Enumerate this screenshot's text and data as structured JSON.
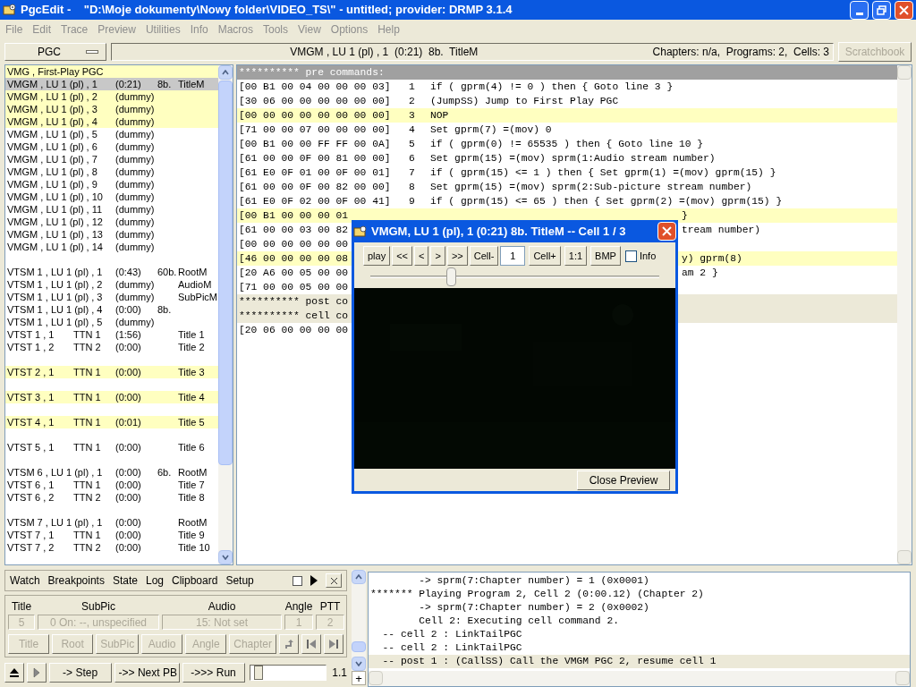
{
  "window": {
    "title": "PgcEdit -    \"D:\\Moje dokumenty\\Nowy folder\\VIDEO_TS\\\" - untitled; provider: DRMP 3.1.4"
  },
  "menu": [
    "File",
    "Edit",
    "Trace",
    "Preview",
    "Utilities",
    "Info",
    "Macros",
    "Tools",
    "View",
    "Options",
    "Help"
  ],
  "toolbar": {
    "selector": "PGC",
    "current": "VMGM , LU 1 (pl) , 1  (0:21)  8b.  TitleM",
    "summary": "Chapters: n/a,  Programs: 2,  Cells: 3",
    "scratchbook": {
      "label": "Scratchbook",
      "disabled": true
    }
  },
  "pgc_list": [
    {
      "kind": "item",
      "name": "VMG , First-Play PGC",
      "highlighted": true,
      "selected": false
    },
    {
      "kind": "item",
      "name": "VMGM , LU 1 (pl) , 1",
      "time": "(0:21)",
      "size": "8b.",
      "type": "TitleM",
      "highlighted": false,
      "selected": true
    },
    {
      "kind": "item",
      "name": "VMGM , LU 1 (pl) , 2",
      "time": "(dummy)",
      "highlighted": true,
      "selected": false
    },
    {
      "kind": "item",
      "name": "VMGM , LU 1 (pl) , 3",
      "time": "(dummy)",
      "highlighted": true,
      "selected": false
    },
    {
      "kind": "item",
      "name": "VMGM , LU 1 (pl) , 4",
      "time": "(dummy)",
      "highlighted": true,
      "selected": false
    },
    {
      "kind": "item",
      "name": "VMGM , LU 1 (pl) , 5",
      "time": "(dummy)",
      "highlighted": false,
      "selected": false
    },
    {
      "kind": "item",
      "name": "VMGM , LU 1 (pl) , 6",
      "time": "(dummy)",
      "highlighted": false,
      "selected": false
    },
    {
      "kind": "item",
      "name": "VMGM , LU 1 (pl) , 7",
      "time": "(dummy)",
      "highlighted": false,
      "selected": false
    },
    {
      "kind": "item",
      "name": "VMGM , LU 1 (pl) , 8",
      "time": "(dummy)",
      "highlighted": false,
      "selected": false
    },
    {
      "kind": "item",
      "name": "VMGM , LU 1 (pl) , 9",
      "time": "(dummy)",
      "highlighted": false,
      "selected": false
    },
    {
      "kind": "item",
      "name": "VMGM , LU 1 (pl) , 10",
      "time": "(dummy)",
      "highlighted": false,
      "selected": false
    },
    {
      "kind": "item",
      "name": "VMGM , LU 1 (pl) , 11",
      "time": "(dummy)",
      "highlighted": false,
      "selected": false
    },
    {
      "kind": "item",
      "name": "VMGM , LU 1 (pl) , 12",
      "time": "(dummy)",
      "highlighted": false,
      "selected": false
    },
    {
      "kind": "item",
      "name": "VMGM , LU 1 (pl) , 13",
      "time": "(dummy)",
      "highlighted": false,
      "selected": false
    },
    {
      "kind": "item",
      "name": "VMGM , LU 1 (pl) , 14",
      "time": "(dummy)",
      "highlighted": false,
      "selected": false
    },
    {
      "kind": "gap"
    },
    {
      "kind": "item",
      "name": "VTSM 1 , LU 1 (pl) , 1",
      "time": "(0:43)",
      "size": "60b.",
      "type": "RootM",
      "highlighted": false,
      "selected": false
    },
    {
      "kind": "item",
      "name": "VTSM 1 , LU 1 (pl) , 2",
      "time": "(dummy)",
      "type": "AudioM",
      "highlighted": false,
      "selected": false
    },
    {
      "kind": "item",
      "name": "VTSM 1 , LU 1 (pl) , 3",
      "time": "(dummy)",
      "type": "SubPicM",
      "highlighted": false,
      "selected": false
    },
    {
      "kind": "item",
      "name": "VTSM 1 , LU 1 (pl) , 4",
      "time": "(0:00)",
      "size": "8b.",
      "highlighted": false,
      "selected": false
    },
    {
      "kind": "item",
      "name": "VTSM 1 , LU 1 (pl) , 5",
      "time": "(dummy)",
      "highlighted": false,
      "selected": false
    },
    {
      "kind": "item",
      "name": "VTST 1 , 1",
      "ttn": "TTN 1",
      "time": "(1:56)",
      "type": "Title 1",
      "highlighted": false,
      "selected": false
    },
    {
      "kind": "item",
      "name": "VTST 1 , 2",
      "ttn": "TTN 2",
      "time": "(0:00)",
      "type": "Title 2",
      "highlighted": false,
      "selected": false
    },
    {
      "kind": "gap"
    },
    {
      "kind": "item",
      "name": "VTST 2 , 1",
      "ttn": "TTN 1",
      "time": "(0:00)",
      "type": "Title 3",
      "highlighted": true,
      "selected": false
    },
    {
      "kind": "gap"
    },
    {
      "kind": "item",
      "name": "VTST 3 , 1",
      "ttn": "TTN 1",
      "time": "(0:00)",
      "type": "Title 4",
      "highlighted": true,
      "selected": false
    },
    {
      "kind": "gap"
    },
    {
      "kind": "item",
      "name": "VTST 4 , 1",
      "ttn": "TTN 1",
      "time": "(0:01)",
      "type": "Title 5",
      "highlighted": true,
      "selected": false
    },
    {
      "kind": "gap"
    },
    {
      "kind": "item",
      "name": "VTST 5 , 1",
      "ttn": "TTN 1",
      "time": "(0:00)",
      "type": "Title 6",
      "highlighted": false,
      "selected": false
    },
    {
      "kind": "gap"
    },
    {
      "kind": "item",
      "name": "VTSM 6 , LU 1 (pl) , 1",
      "time": "(0:00)",
      "size": "6b.",
      "type": "RootM",
      "highlighted": false,
      "selected": false
    },
    {
      "kind": "item",
      "name": "VTST 6 , 1",
      "ttn": "TTN 1",
      "time": "(0:00)",
      "type": "Title 7",
      "highlighted": false,
      "selected": false
    },
    {
      "kind": "item",
      "name": "VTST 6 , 2",
      "ttn": "TTN 2",
      "time": "(0:00)",
      "type": "Title 8",
      "highlighted": false,
      "selected": false
    },
    {
      "kind": "gap"
    },
    {
      "kind": "item",
      "name": "VTSM 7 , LU 1 (pl) , 1",
      "time": "(0:00)",
      "type": "RootM",
      "highlighted": false,
      "selected": false
    },
    {
      "kind": "item",
      "name": "VTST 7 , 1",
      "ttn": "TTN 1",
      "time": "(0:00)",
      "type": "Title 9",
      "highlighted": false,
      "selected": false
    },
    {
      "kind": "item",
      "name": "VTST 7 , 2",
      "ttn": "TTN 2",
      "time": "(0:00)",
      "type": "Title 10",
      "highlighted": false,
      "selected": false
    }
  ],
  "code": [
    {
      "kind": "header",
      "text": "********** pre commands:",
      "selected": true
    },
    {
      "kind": "cmd",
      "hex": "[00 B1 00 04 00 00 00 03]",
      "num": "1",
      "cmd": "if ( gprm(4) != 0 ) then { Goto line 3 }",
      "highlighted": false
    },
    {
      "kind": "cmd",
      "hex": "[30 06 00 00 00 00 00 00]",
      "num": "2",
      "cmd": "(JumpSS) Jump to First Play PGC",
      "highlighted": false
    },
    {
      "kind": "cmd",
      "hex": "[00 00 00 00 00 00 00 00]",
      "num": "3",
      "cmd": "NOP",
      "highlighted": true
    },
    {
      "kind": "cmd",
      "hex": "[71 00 00 07 00 00 00 00]",
      "num": "4",
      "cmd": "Set gprm(7) =(mov) 0",
      "highlighted": false
    },
    {
      "kind": "cmd",
      "hex": "[00 B1 00 00 FF FF 00 0A]",
      "num": "5",
      "cmd": "if ( gprm(0) != 65535 ) then { Goto line 10 }",
      "highlighted": false
    },
    {
      "kind": "cmd",
      "hex": "[61 00 00 0F 00 81 00 00]",
      "num": "6",
      "cmd": "Set gprm(15) =(mov) sprm(1:Audio stream number)",
      "highlighted": false
    },
    {
      "kind": "cmd",
      "hex": "[61 E0 0F 01 00 0F 00 01]",
      "num": "7",
      "cmd": "if ( gprm(15) <= 1 ) then { Set gprm(1) =(mov) gprm(15) }",
      "highlighted": false
    },
    {
      "kind": "cmd",
      "hex": "[61 00 00 0F 00 82 00 00]",
      "num": "8",
      "cmd": "Set gprm(15) =(mov) sprm(2:Sub-picture stream number)",
      "highlighted": false
    },
    {
      "kind": "cmd",
      "hex": "[61 E0 0F 02 00 0F 00 41]",
      "num": "9",
      "cmd": "if ( gprm(15) <= 65 ) then { Set gprm(2) =(mov) gprm(15) }",
      "highlighted": false
    },
    {
      "kind": "partial",
      "left": "[00 B1 00 00 00 01",
      "right": "}",
      "highlighted": true
    },
    {
      "kind": "partial",
      "left": "[61 00 00 03 00 82",
      "right": "tream number)",
      "highlighted": false
    },
    {
      "kind": "partial",
      "left": "[00 00 00 00 00 00",
      "highlighted": false
    },
    {
      "kind": "partial",
      "left": "[46 00 00 00 00 08",
      "right": "y) gprm(8)",
      "highlighted": true
    },
    {
      "kind": "partial",
      "left": "[20 A6 00 05 00 00",
      "right": "am 2 }",
      "highlighted": false
    },
    {
      "kind": "partial",
      "left": "[71 00 00 05 00 00",
      "highlighted": false
    },
    {
      "kind": "header",
      "text": "********** post co",
      "selected": false
    },
    {
      "kind": "header",
      "text": "********** cell co",
      "selected": false
    },
    {
      "kind": "partial",
      "left": "[20 06 00 00 00 00",
      "highlighted": false
    }
  ],
  "preview": {
    "title": "VMGM, LU 1 (pl), 1 (0:21) 8b. TitleM -- Cell 1 / 3",
    "buttons": [
      "play",
      "<<",
      "<",
      ">",
      ">>",
      "Cell-"
    ],
    "cell": "1",
    "buttons_after": [
      "Cell+",
      "1:1",
      "BMP"
    ],
    "info": {
      "label": "Info",
      "checked": false
    },
    "level": 0.28,
    "close": "Close Preview"
  },
  "debugger": {
    "tabs": [
      "Watch",
      "Breakpoints",
      "State",
      "Log",
      "Clipboard",
      "Setup"
    ],
    "pin": {
      "checked": false
    },
    "fields": [
      {
        "label": "Title",
        "value": "5"
      },
      {
        "label": "SubPic",
        "value": "0 On: --, unspecified"
      },
      {
        "label": "Audio",
        "value": "15: Not set"
      },
      {
        "label": "Angle",
        "value": "1"
      },
      {
        "label": "PTT",
        "value": "2"
      }
    ],
    "menu_buttons": [
      {
        "label": "Title",
        "disabled": true
      },
      {
        "label": "Root",
        "disabled": true
      },
      {
        "label": "SubPic",
        "disabled": true
      },
      {
        "label": "Audio",
        "disabled": true
      },
      {
        "label": "Angle",
        "disabled": true
      },
      {
        "label": "Chapter",
        "disabled": true
      }
    ],
    "run_buttons": [
      "-> Step",
      "->> Next PB",
      "->>> Run"
    ],
    "speed": {
      "level": 0.05,
      "reading": "1.1"
    },
    "plus": "+"
  },
  "log": [
    {
      "text": "        -> sprm(7:Chapter number) = 1 (0x0001)",
      "highlighted": false
    },
    {
      "text": "******* Playing Program 2, Cell 2 (0:00.12) (Chapter 2)",
      "highlighted": false
    },
    {
      "text": "        -> sprm(7:Chapter number) = 2 (0x0002)",
      "highlighted": false
    },
    {
      "text": "        Cell 2: Executing cell command 2.",
      "highlighted": false
    },
    {
      "text": "  -- cell 2 : LinkTailPGC",
      "highlighted": false
    },
    {
      "text": "  -- cell 2 : LinkTailPGC",
      "highlighted": false
    },
    {
      "text": "  -- post 1 : (CallSS) Call the VMGM PGC 2, resume cell 1",
      "highlighted": true
    }
  ]
}
